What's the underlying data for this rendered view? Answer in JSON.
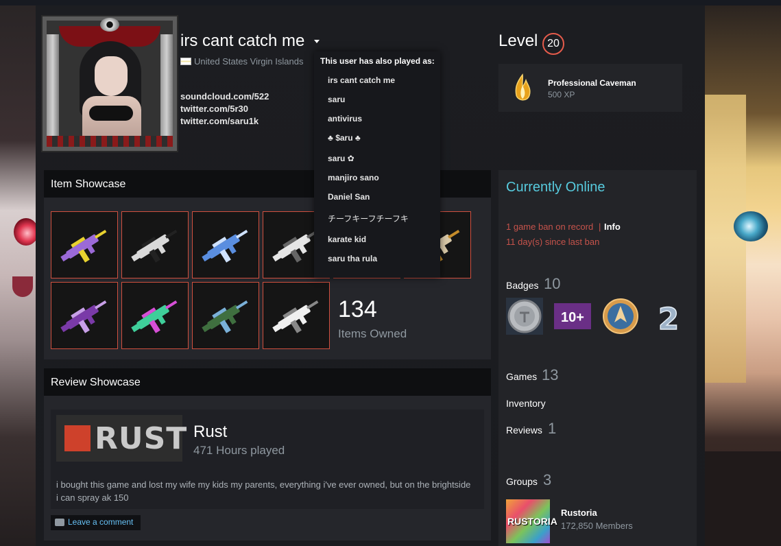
{
  "profile": {
    "persona_name": "irs cant catch me",
    "location": "United States Virgin Islands",
    "links": [
      "soundcloud.com/522",
      "twitter.com/5r30",
      "twitter.com/saru1k"
    ]
  },
  "alias_dropdown": {
    "title": "This user has also played as:",
    "aliases": [
      "irs cant catch me",
      "saru",
      "antivirus",
      "♣ $aru ♣",
      "saru ✿",
      "manjiro sano",
      "Daniel San",
      "チーフキーフチーフキ",
      "karate kid",
      "saru tha rula"
    ]
  },
  "level": {
    "label": "Level",
    "value": "20",
    "favorite_badge": {
      "name": "Professional Caveman",
      "xp": "500 XP"
    }
  },
  "item_showcase": {
    "title": "Item Showcase",
    "count": "134",
    "count_label": "Items Owned",
    "items": [
      {
        "name": "smg-purple-yellow",
        "color": "#9b6ad8",
        "accent": "#e8d22f"
      },
      {
        "name": "rifle-black-white",
        "color": "#d9d9d9",
        "accent": "#222222"
      },
      {
        "name": "smg-blue-camo",
        "color": "#5a8ee0",
        "accent": "#cfe2ff"
      },
      {
        "name": "rifle-white",
        "color": "#e6e6e6",
        "accent": "#666666"
      },
      {
        "name": "rifle-hidden",
        "color": "#cccccc",
        "accent": "#444444"
      },
      {
        "name": "rifle-tan",
        "color": "#d9c9a8",
        "accent": "#c38b2a"
      },
      {
        "name": "smg-purple-dark",
        "color": "#7a3aa8",
        "accent": "#c8a0e8"
      },
      {
        "name": "rifle-neon",
        "color": "#3fcf9a",
        "accent": "#d64fd6"
      },
      {
        "name": "rifle-green-camo",
        "color": "#3f6f3f",
        "accent": "#7ab0d8"
      },
      {
        "name": "rifle-white-2",
        "color": "#f0f0f0",
        "accent": "#888888"
      }
    ]
  },
  "review_showcase": {
    "title": "Review Showcase",
    "game_logo": "RUST",
    "game": "Rust",
    "hours": "471 Hours played",
    "text": "i bought this game and lost my wife my kids my parents, everything i've ever owned, but on the brightside i can spray ak 150",
    "comment_label": "Leave a comment"
  },
  "sidebar": {
    "status": "Currently Online",
    "ban_line": "1 game ban on record",
    "ban_separator": "|",
    "ban_info": "Info",
    "ban_since": "11 day(s) since last ban",
    "badges_label": "Badges",
    "badges_count": "10",
    "badges": [
      {
        "name": "coin-badge",
        "text": ""
      },
      {
        "name": "years-badge",
        "text": "10+"
      },
      {
        "name": "csgo-badge",
        "text": ""
      },
      {
        "name": "two-badge",
        "text": "2"
      }
    ],
    "games_label": "Games",
    "games_count": "13",
    "inventory_label": "Inventory",
    "reviews_label": "Reviews",
    "reviews_count": "1",
    "groups_label": "Groups",
    "groups_count": "3",
    "group": {
      "icon_text": "RUSTORIA",
      "name": "Rustoria",
      "members": "172,850 Members"
    }
  },
  "colors": {
    "accent_red": "#d1503f",
    "online_blue": "#57cbde",
    "ban_red": "#c6534b",
    "link_blue": "#66c0f4"
  }
}
